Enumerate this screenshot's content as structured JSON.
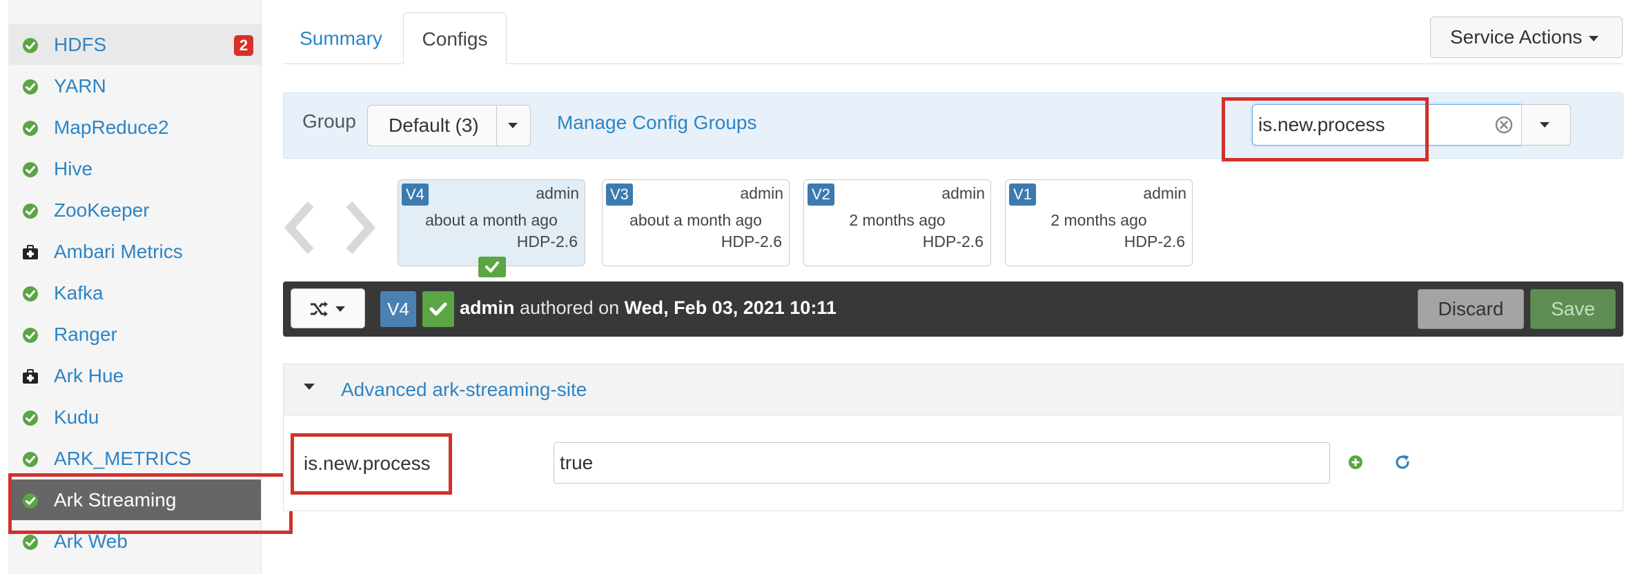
{
  "sidebar": {
    "services": [
      {
        "name": "HDFS",
        "icon": "check-circle-icon",
        "badge": "2"
      },
      {
        "name": "YARN",
        "icon": "check-circle-icon"
      },
      {
        "name": "MapReduce2",
        "icon": "check-circle-icon"
      },
      {
        "name": "Hive",
        "icon": "check-circle-icon"
      },
      {
        "name": "ZooKeeper",
        "icon": "check-circle-icon"
      },
      {
        "name": "Ambari Metrics",
        "icon": "medkit-icon"
      },
      {
        "name": "Kafka",
        "icon": "check-circle-icon"
      },
      {
        "name": "Ranger",
        "icon": "check-circle-icon"
      },
      {
        "name": "Ark Hue",
        "icon": "medkit-icon"
      },
      {
        "name": "Kudu",
        "icon": "check-circle-icon"
      },
      {
        "name": "ARK_METRICS",
        "icon": "check-circle-icon"
      },
      {
        "name": "Ark Streaming",
        "icon": "check-circle-icon",
        "active": true
      },
      {
        "name": "Ark Web",
        "icon": "check-circle-icon"
      }
    ]
  },
  "tabs": {
    "summary": "Summary",
    "configs": "Configs",
    "active": "Configs"
  },
  "header": {
    "service_actions": "Service Actions"
  },
  "group_bar": {
    "label": "Group",
    "selected_group": "Default (3)",
    "manage_link": "Manage Config Groups",
    "search_value": "is.new.process"
  },
  "versions": [
    {
      "tag": "V4",
      "author": "admin",
      "time": "about a month ago",
      "stack": "HDP-2.6",
      "current": true
    },
    {
      "tag": "V3",
      "author": "admin",
      "time": "about a month ago",
      "stack": "HDP-2.6"
    },
    {
      "tag": "V2",
      "author": "admin",
      "time": "2 months ago",
      "stack": "HDP-2.6"
    },
    {
      "tag": "V1",
      "author": "admin",
      "time": "2 months ago",
      "stack": "HDP-2.6"
    }
  ],
  "author_bar": {
    "version": "V4",
    "author": "admin",
    "authored_on_text": "authored on",
    "date": "Wed, Feb 03, 2021 10:11",
    "discard": "Discard",
    "save": "Save"
  },
  "section": {
    "title": "Advanced ark-streaming-site",
    "property_name": "is.new.process",
    "property_value": "true"
  },
  "colors": {
    "link": "#2d84c4",
    "status_ok": "#5aa544",
    "badge": "#d9302a",
    "highlight": "#d0312d",
    "active_row": "#666666",
    "author_bar": "#383838"
  }
}
